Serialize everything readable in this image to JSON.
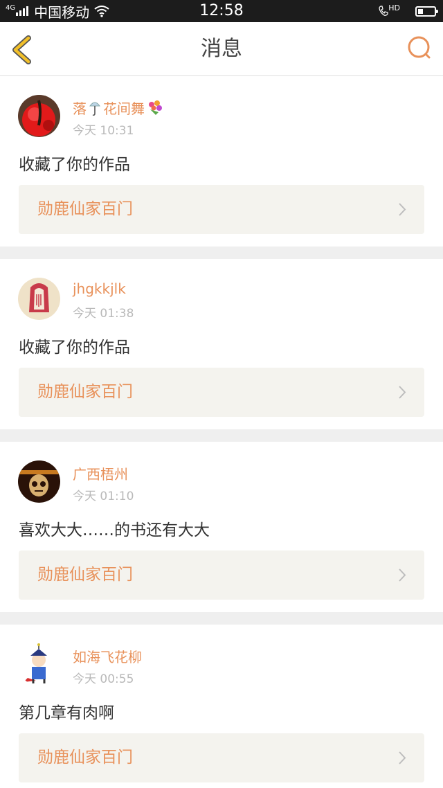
{
  "status_bar": {
    "network_gen": "4G",
    "carrier": "中国移动",
    "time": "12:58",
    "call_badge": "HD",
    "battery_level": 0.3
  },
  "header": {
    "title": "消息",
    "back_icon": "chevron-left-icon",
    "search_icon": "search-icon",
    "accent_color": "#e8915a",
    "back_color": "#f2c02a"
  },
  "messages": [
    {
      "username": "落",
      "username_mid": "花间舞",
      "time": "今天 10:31",
      "text": "收藏了你的作品",
      "work": "勋鹿仙家百门"
    },
    {
      "username": "jhgkkjlk",
      "time": "今天 01:38",
      "text": "收藏了你的作品",
      "work": "勋鹿仙家百门"
    },
    {
      "username": "广西梧州",
      "time": "今天 01:10",
      "text": "喜欢大大……的书还有大大",
      "work": "勋鹿仙家百门"
    },
    {
      "username": "如海飞花柳",
      "time": "今天 00:55",
      "text": "第几章有肉啊",
      "work": "勋鹿仙家百门"
    }
  ]
}
